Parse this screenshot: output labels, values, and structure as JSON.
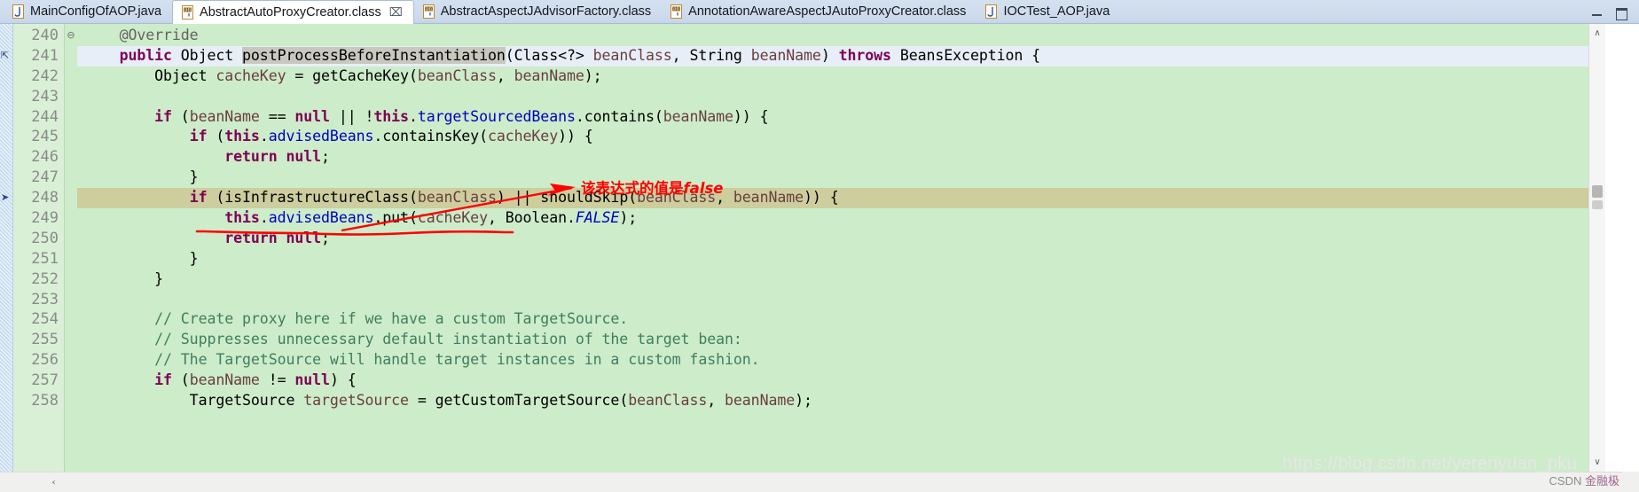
{
  "window": {
    "minimize_label": "Minimize",
    "maximize_label": "Maximize"
  },
  "tabs": [
    {
      "label": "MainConfigOfAOP.java",
      "icon": "java-file-icon",
      "active": false,
      "closable": false
    },
    {
      "label": "AbstractAutoProxyCreator.class",
      "icon": "class-file-icon",
      "active": true,
      "closable": true,
      "close_glyph": "⌧"
    },
    {
      "label": "AbstractAspectJAdvisorFactory.class",
      "icon": "class-file-icon",
      "active": false,
      "closable": false
    },
    {
      "label": "AnnotationAwareAspectJAutoProxyCreator.class",
      "icon": "class-file-icon",
      "active": false,
      "closable": false
    },
    {
      "label": "IOCTest_AOP.java",
      "icon": "java-file-icon",
      "active": false,
      "closable": false
    }
  ],
  "editor": {
    "first_line": 240,
    "current_line": 241,
    "debug_line": 248,
    "lines": [
      {
        "num": "240",
        "fold": "⊖",
        "marker": "",
        "state": "normal",
        "tokens": [
          {
            "t": "    ",
            "c": "pln"
          },
          {
            "t": "@Override",
            "c": "ann"
          }
        ]
      },
      {
        "num": "241",
        "fold": "",
        "marker": "collapse-arrow",
        "state": "current",
        "tokens": [
          {
            "t": "    ",
            "c": "pln"
          },
          {
            "t": "public",
            "c": "kw"
          },
          {
            "t": " ",
            "c": "pln"
          },
          {
            "t": "Object",
            "c": "pln"
          },
          {
            "t": " ",
            "c": "pln"
          },
          {
            "t": "postProcessBeforeInstantiation",
            "c": "pln selword"
          },
          {
            "t": "(",
            "c": "pln"
          },
          {
            "t": "Class<?> ",
            "c": "pln"
          },
          {
            "t": "beanClass",
            "c": "par"
          },
          {
            "t": ", String ",
            "c": "pln"
          },
          {
            "t": "beanName",
            "c": "par"
          },
          {
            "t": ") ",
            "c": "pln"
          },
          {
            "t": "throws",
            "c": "kw"
          },
          {
            "t": " BeansException {",
            "c": "pln"
          }
        ]
      },
      {
        "num": "242",
        "fold": "",
        "marker": "",
        "state": "normal",
        "tokens": [
          {
            "t": "        Object ",
            "c": "pln"
          },
          {
            "t": "cacheKey",
            "c": "par"
          },
          {
            "t": " = getCacheKey(",
            "c": "pln"
          },
          {
            "t": "beanClass",
            "c": "par"
          },
          {
            "t": ", ",
            "c": "pln"
          },
          {
            "t": "beanName",
            "c": "par"
          },
          {
            "t": ");",
            "c": "pln"
          }
        ]
      },
      {
        "num": "243",
        "fold": "",
        "marker": "",
        "state": "normal",
        "tokens": []
      },
      {
        "num": "244",
        "fold": "",
        "marker": "",
        "state": "normal",
        "tokens": [
          {
            "t": "        ",
            "c": "pln"
          },
          {
            "t": "if",
            "c": "kw"
          },
          {
            "t": " (",
            "c": "pln"
          },
          {
            "t": "beanName",
            "c": "par"
          },
          {
            "t": " == ",
            "c": "pln"
          },
          {
            "t": "null",
            "c": "kw"
          },
          {
            "t": " || !",
            "c": "pln"
          },
          {
            "t": "this",
            "c": "kw"
          },
          {
            "t": ".",
            "c": "pln"
          },
          {
            "t": "targetSourcedBeans",
            "c": "fld"
          },
          {
            "t": ".contains(",
            "c": "pln"
          },
          {
            "t": "beanName",
            "c": "par"
          },
          {
            "t": ")) {",
            "c": "pln"
          }
        ]
      },
      {
        "num": "245",
        "fold": "",
        "marker": "",
        "state": "normal",
        "tokens": [
          {
            "t": "            ",
            "c": "pln"
          },
          {
            "t": "if",
            "c": "kw"
          },
          {
            "t": " (",
            "c": "pln"
          },
          {
            "t": "this",
            "c": "kw"
          },
          {
            "t": ".",
            "c": "pln"
          },
          {
            "t": "advisedBeans",
            "c": "fld"
          },
          {
            "t": ".containsKey(",
            "c": "pln"
          },
          {
            "t": "cacheKey",
            "c": "par"
          },
          {
            "t": ")) {",
            "c": "pln"
          }
        ]
      },
      {
        "num": "246",
        "fold": "",
        "marker": "",
        "state": "normal",
        "tokens": [
          {
            "t": "                ",
            "c": "pln"
          },
          {
            "t": "return",
            "c": "kw"
          },
          {
            "t": " ",
            "c": "pln"
          },
          {
            "t": "null",
            "c": "kw"
          },
          {
            "t": ";",
            "c": "pln"
          }
        ]
      },
      {
        "num": "247",
        "fold": "",
        "marker": "",
        "state": "normal",
        "tokens": [
          {
            "t": "            }",
            "c": "pln"
          }
        ]
      },
      {
        "num": "248",
        "fold": "",
        "marker": "debug-arrow",
        "state": "debug",
        "tokens": [
          {
            "t": "            ",
            "c": "pln"
          },
          {
            "t": "if",
            "c": "kw"
          },
          {
            "t": " (isInfrastructureClass(",
            "c": "pln"
          },
          {
            "t": "beanClass",
            "c": "par"
          },
          {
            "t": ") || shouldSkip(",
            "c": "pln"
          },
          {
            "t": "beanClass",
            "c": "par"
          },
          {
            "t": ", ",
            "c": "pln"
          },
          {
            "t": "beanName",
            "c": "par"
          },
          {
            "t": ")) {",
            "c": "pln"
          }
        ]
      },
      {
        "num": "249",
        "fold": "",
        "marker": "",
        "state": "normal",
        "tokens": [
          {
            "t": "                ",
            "c": "pln"
          },
          {
            "t": "this",
            "c": "kw"
          },
          {
            "t": ".",
            "c": "pln"
          },
          {
            "t": "advisedBeans",
            "c": "fld"
          },
          {
            "t": ".put(",
            "c": "pln"
          },
          {
            "t": "cacheKey",
            "c": "par"
          },
          {
            "t": ", Boolean.",
            "c": "pln"
          },
          {
            "t": "FALSE",
            "c": "stfld"
          },
          {
            "t": ");",
            "c": "pln"
          }
        ]
      },
      {
        "num": "250",
        "fold": "",
        "marker": "",
        "state": "normal",
        "tokens": [
          {
            "t": "                ",
            "c": "pln"
          },
          {
            "t": "return",
            "c": "kw"
          },
          {
            "t": " ",
            "c": "pln"
          },
          {
            "t": "null",
            "c": "kw"
          },
          {
            "t": ";",
            "c": "pln"
          }
        ]
      },
      {
        "num": "251",
        "fold": "",
        "marker": "",
        "state": "normal",
        "tokens": [
          {
            "t": "            }",
            "c": "pln"
          }
        ]
      },
      {
        "num": "252",
        "fold": "",
        "marker": "",
        "state": "normal",
        "tokens": [
          {
            "t": "        }",
            "c": "pln"
          }
        ]
      },
      {
        "num": "253",
        "fold": "",
        "marker": "",
        "state": "normal",
        "tokens": []
      },
      {
        "num": "254",
        "fold": "",
        "marker": "",
        "state": "normal",
        "tokens": [
          {
            "t": "        ",
            "c": "pln"
          },
          {
            "t": "// Create proxy here if we have a custom TargetSource.",
            "c": "cmt"
          }
        ]
      },
      {
        "num": "255",
        "fold": "",
        "marker": "",
        "state": "normal",
        "tokens": [
          {
            "t": "        ",
            "c": "pln"
          },
          {
            "t": "// Suppresses unnecessary default instantiation of the target bean:",
            "c": "cmt"
          }
        ]
      },
      {
        "num": "256",
        "fold": "",
        "marker": "",
        "state": "normal",
        "tokens": [
          {
            "t": "        ",
            "c": "pln"
          },
          {
            "t": "// The TargetSource will handle target instances in a custom fashion.",
            "c": "cmt"
          }
        ]
      },
      {
        "num": "257",
        "fold": "",
        "marker": "",
        "state": "normal",
        "tokens": [
          {
            "t": "        ",
            "c": "pln"
          },
          {
            "t": "if",
            "c": "kw"
          },
          {
            "t": " (",
            "c": "pln"
          },
          {
            "t": "beanName",
            "c": "par"
          },
          {
            "t": " != ",
            "c": "pln"
          },
          {
            "t": "null",
            "c": "kw"
          },
          {
            "t": ") {",
            "c": "pln"
          }
        ]
      },
      {
        "num": "258",
        "fold": "",
        "marker": "",
        "state": "normal",
        "tokens": [
          {
            "t": "            TargetSource ",
            "c": "pln"
          },
          {
            "t": "targetSource",
            "c": "par"
          },
          {
            "t": " = getCustomTargetSource(",
            "c": "pln"
          },
          {
            "t": "beanClass",
            "c": "par"
          },
          {
            "t": ", ",
            "c": "pln"
          },
          {
            "t": "beanName",
            "c": "par"
          },
          {
            "t": ");",
            "c": "pln"
          }
        ]
      }
    ]
  },
  "annotation": {
    "text_cn": "该表达式的值是",
    "text_value": "false",
    "color": "#ff0000",
    "arrow_name": "red-arrow-annotation",
    "underline_name": "red-underline-annotation"
  },
  "scrollbars": {
    "v_up_glyph": "∧",
    "v_down_glyph": "∨",
    "h_left_glyph": "‹",
    "h_right_glyph": "›"
  },
  "watermark": {
    "url": "https://blog.csdn.net/yerenyuan_pku",
    "brand": "CSDN ",
    "brand_cn": "金融极"
  },
  "colors": {
    "editor_bg": "#cdecca",
    "gutter_bg": "#d9f0d6",
    "current_line": "#e8eef8",
    "debug_line": "#cdcd9e",
    "keyword": "#7f0055",
    "field": "#0000c0",
    "comment": "#3f7f5f",
    "parameter": "#6a3e3e",
    "annotation_red": "#ff0000"
  }
}
